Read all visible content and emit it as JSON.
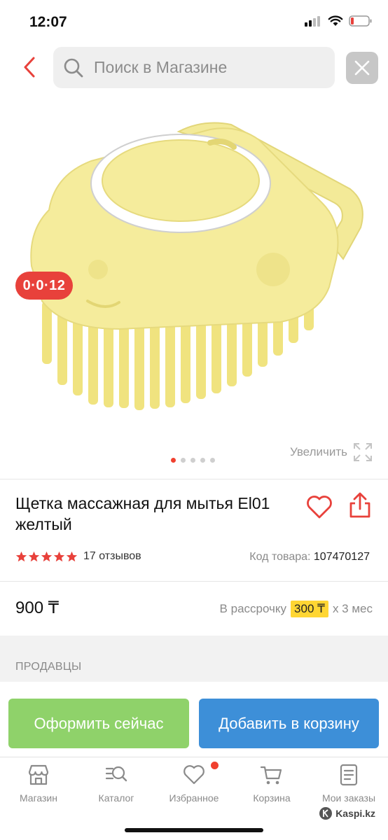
{
  "status_bar": {
    "time": "12:07"
  },
  "search": {
    "placeholder": "Поиск в Магазине"
  },
  "gallery": {
    "promo_badge": "0·0·12",
    "zoom_label": "Увеличить",
    "image_count": 5,
    "active_index": 0
  },
  "product": {
    "title": "Щетка массажная для мытья El01 желтый",
    "rating": 5,
    "reviews": "17 отзывов",
    "sku_label": "Код товара:",
    "sku_value": "107470127",
    "price": "900 ₸",
    "installment_prefix": "В рассрочку",
    "installment_amount": "300 ₸",
    "installment_suffix": "х 3 мес"
  },
  "sellers": {
    "label": "ПРОДАВЦЫ"
  },
  "actions": {
    "checkout_label": "Оформить сейчас",
    "add_to_cart_label": "Добавить в корзину"
  },
  "tabbar": {
    "items": [
      {
        "label": "Магазин",
        "icon": "store-icon"
      },
      {
        "label": "Каталог",
        "icon": "catalog-search-icon"
      },
      {
        "label": "Избранное",
        "icon": "heart-icon"
      },
      {
        "label": "Корзина",
        "icon": "cart-icon"
      },
      {
        "label": "Мои заказы",
        "icon": "orders-icon"
      }
    ]
  },
  "watermark": {
    "text": "Kaspi.kz"
  },
  "colors": {
    "accent_red": "#f0402f",
    "checkout_green": "#8fd26a",
    "cart_blue": "#3d8fd8",
    "installment_yellow": "#ffd633"
  }
}
